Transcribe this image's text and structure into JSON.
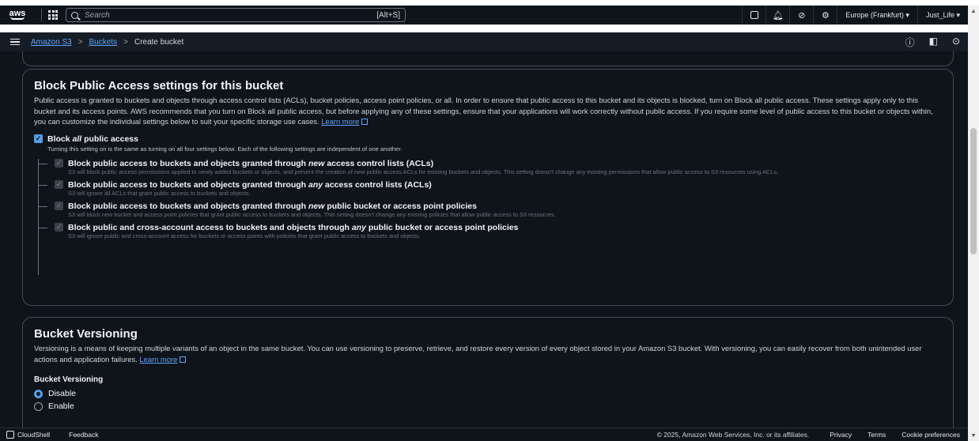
{
  "topnav": {
    "logo_text": "aws",
    "search_placeholder": "Search",
    "search_shortcut": "[Alt+S]",
    "region": "Europe (Frankfurt) ▾",
    "user": "Just_Life ▾"
  },
  "breadcrumb": {
    "items": [
      "Amazon S3",
      "Buckets",
      "Create bucket"
    ]
  },
  "block_public_access": {
    "title": "Block Public Access settings for this bucket",
    "description": "Public access is granted to buckets and objects through access control lists (ACLs), bucket policies, access point policies, or all. In order to ensure that public access to this bucket and its objects is blocked, turn on Block all public access. These settings apply only to this bucket and its access points. AWS recommends that you turn on Block all public access, but before applying any of these settings, ensure that your applications will work correctly without public access. If you require some level of public access to this bucket or objects within, you can customize the individual settings below to suit your specific storage use cases.",
    "learn_more": "Learn more",
    "block_all": {
      "label_pre": "Block ",
      "label_em": "all",
      "label_post": " public access",
      "description": "Turning this setting on is the same as turning on all four settings below. Each of the following settings are independent of one another.",
      "checked": true
    },
    "options": [
      {
        "label_pre": "Block public access to buckets and objects granted through ",
        "label_em": "new",
        "label_post": " access control lists (ACLs)",
        "description": "S3 will block public access permissions applied to newly added buckets or objects, and prevent the creation of new public access ACLs for existing buckets and objects. This setting doesn't change any existing permissions that allow public access to S3 resources using ACLs."
      },
      {
        "label_pre": "Block public access to buckets and objects granted through ",
        "label_em": "any",
        "label_post": " access control lists (ACLs)",
        "description": "S3 will ignore all ACLs that grant public access to buckets and objects."
      },
      {
        "label_pre": "Block public access to buckets and objects granted through ",
        "label_em": "new",
        "label_post": " public bucket or access point policies",
        "description": "S3 will block new bucket and access point policies that grant public access to buckets and objects. This setting doesn't change any existing policies that allow public access to S3 resources."
      },
      {
        "label_pre": "Block public and cross-account access to buckets and objects through ",
        "label_em": "any",
        "label_post": " public bucket or access point policies",
        "description": "S3 will ignore public and cross-account access for buckets or access points with policies that grant public access to buckets and objects."
      }
    ]
  },
  "versioning": {
    "title": "Bucket Versioning",
    "description": "Versioning is a means of keeping multiple variants of an object in the same bucket. You can use versioning to preserve, retrieve, and restore every version of every object stored in your Amazon S3 bucket. With versioning, you can easily recover from both unintended user actions and application failures.",
    "learn_more": "Learn more",
    "field_label": "Bucket Versioning",
    "options": [
      "Disable",
      "Enable"
    ],
    "selected": "Disable"
  },
  "footer": {
    "cloudshell": "CloudShell",
    "feedback": "Feedback",
    "copyright": "© 2025, Amazon Web Services, Inc. or its affiliates.",
    "links": [
      "Privacy",
      "Terms",
      "Cookie preferences"
    ]
  }
}
